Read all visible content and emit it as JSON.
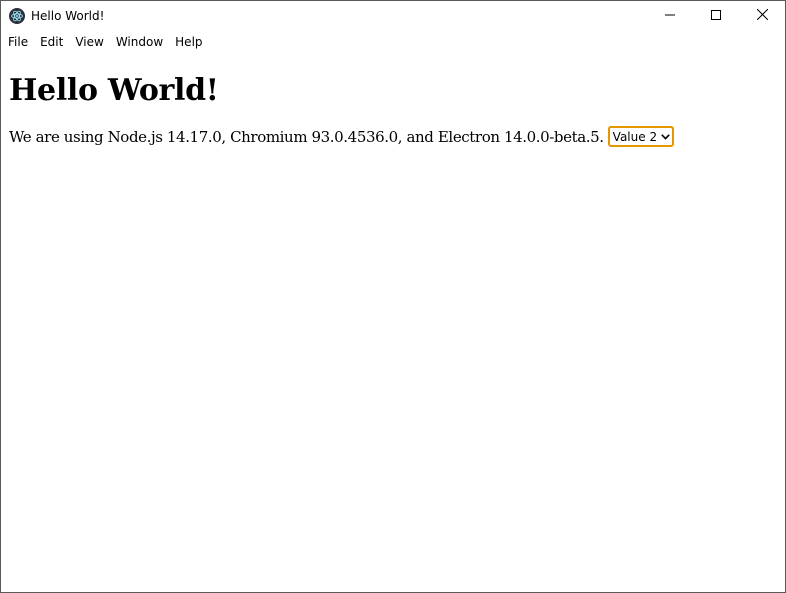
{
  "window": {
    "title": "Hello World!",
    "app_icon": "electron-icon",
    "controls": [
      "minimize-icon",
      "maximize-icon",
      "close-icon"
    ]
  },
  "menu": {
    "items": [
      "File",
      "Edit",
      "View",
      "Window",
      "Help"
    ]
  },
  "main": {
    "heading": "Hello World!",
    "text": "We are using Node.js 14.17.0, Chromium 93.0.4536.0, and Electron 14.0.0-beta.5.",
    "select": {
      "selected": "Value 2",
      "focus_color": "#e59700"
    }
  }
}
